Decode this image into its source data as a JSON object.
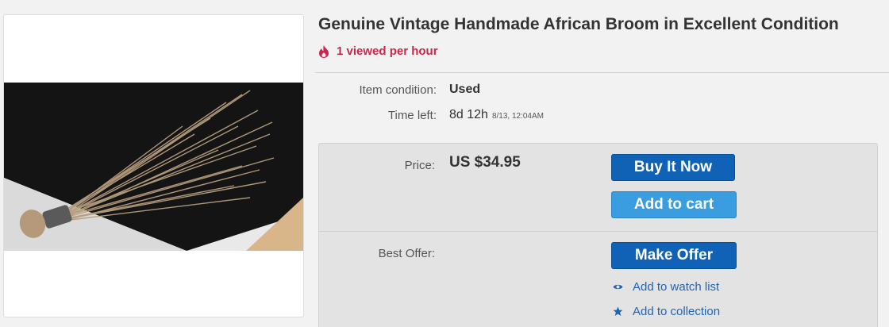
{
  "listing": {
    "title": "Genuine Vintage Handmade African Broom in Excellent Condition",
    "views_text": "1 viewed per hour"
  },
  "details": {
    "condition_label": "Item condition:",
    "condition_value": "Used",
    "time_left_label": "Time left:",
    "time_left_value": "8d 12h",
    "time_left_end": "8/13, 12:04AM"
  },
  "purchase": {
    "price_label": "Price:",
    "price_value": "US $34.95",
    "buy_now_label": "Buy It Now",
    "add_to_cart_label": "Add to cart",
    "best_offer_label": "Best Offer:",
    "make_offer_label": "Make Offer",
    "watch_list_label": "Add to watch list",
    "collection_label": "Add to collection"
  },
  "colors": {
    "views_accent": "#c9264b",
    "primary_button": "#0f62b5",
    "secondary_button": "#3a9de0",
    "link": "#1f63b5"
  },
  "icons": {
    "views": "flame-icon",
    "watch": "eye-icon",
    "collection": "star-icon"
  }
}
